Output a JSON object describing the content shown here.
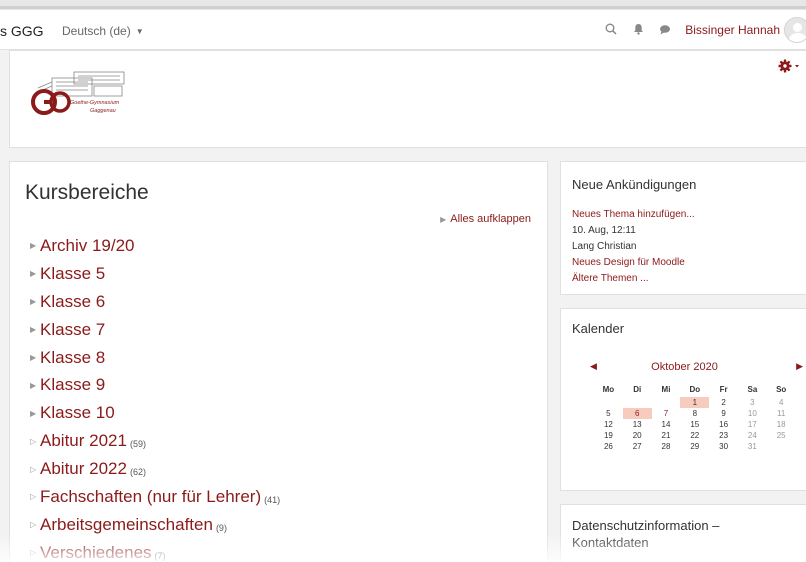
{
  "navbar": {
    "brand": "s GGG",
    "language": "Deutsch (de)",
    "user_name": "Bissinger Hannah"
  },
  "header": {
    "logo_lines": [
      "Goethe-Gymnasium",
      "Gaggenau"
    ],
    "logo_letters": "GG"
  },
  "main": {
    "title": "Kursbereiche",
    "expand_all": "Alles aufklappen",
    "categories": [
      {
        "name": "Archiv 19/20",
        "count": ""
      },
      {
        "name": "Klasse 5",
        "count": ""
      },
      {
        "name": "Klasse 6",
        "count": ""
      },
      {
        "name": "Klasse 7",
        "count": ""
      },
      {
        "name": "Klasse 8",
        "count": ""
      },
      {
        "name": "Klasse 9",
        "count": ""
      },
      {
        "name": "Klasse 10",
        "count": ""
      },
      {
        "name": "Abitur 2021",
        "count": "(59)"
      },
      {
        "name": "Abitur 2022",
        "count": "(62)"
      },
      {
        "name": "Fachschaften (nur für Lehrer)",
        "count": "(41)"
      },
      {
        "name": "Arbeitsgemeinschaften",
        "count": "(9)"
      },
      {
        "name": "Verschiedenes",
        "count": "(7)"
      }
    ]
  },
  "announcements": {
    "title": "Neue Ankündigungen",
    "add_topic": "Neues Thema hinzufügen...",
    "post_date": "10. Aug, 12:11",
    "post_author": "Lang Christian",
    "post_title": "Neues Design für Moodle",
    "older_topics": "Ältere Themen ..."
  },
  "calendar": {
    "title": "Kalender",
    "month": "Oktober 2020",
    "weekdays": [
      "Mo",
      "Di",
      "Mi",
      "Do",
      "Fr",
      "Sa",
      "So"
    ],
    "weeks": [
      [
        "",
        "",
        "",
        "1",
        "2",
        "3",
        "4"
      ],
      [
        "5",
        "6",
        "7",
        "8",
        "9",
        "10",
        "11"
      ],
      [
        "12",
        "13",
        "14",
        "15",
        "16",
        "17",
        "18"
      ],
      [
        "19",
        "20",
        "21",
        "22",
        "23",
        "24",
        "25"
      ],
      [
        "26",
        "27",
        "28",
        "29",
        "30",
        "31",
        ""
      ]
    ],
    "today": "6",
    "highlighted_days": [
      "1",
      "6"
    ],
    "event_days": [
      "6",
      "7"
    ]
  },
  "privacy": {
    "title": "Datenschutzinformation – Kontaktdaten"
  },
  "colors": {
    "accent": "#8b1a1a",
    "today_highlight": "#f7cbbd"
  },
  "icons": {
    "search": "search-icon",
    "notifications": "bell-icon",
    "messages": "chat-bubble-icon",
    "settings": "gear-icon",
    "prev": "triangle-left-icon",
    "next": "triangle-right-icon",
    "expand": "triangle-right-icon"
  }
}
